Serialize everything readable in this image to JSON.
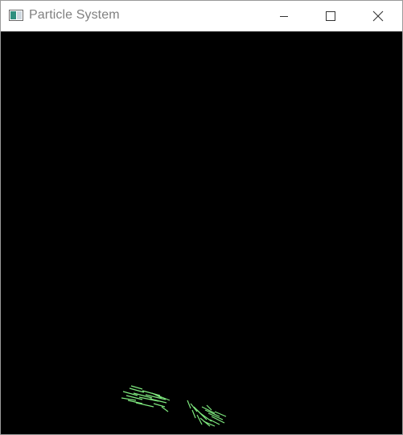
{
  "window": {
    "title": "Particle System",
    "icon": "app-window-icon",
    "controls": {
      "minimize": "minimize-icon",
      "maximize": "maximize-icon",
      "close": "close-icon"
    }
  },
  "canvas": {
    "background": "#000000",
    "particle_color": "#7ee87e"
  }
}
